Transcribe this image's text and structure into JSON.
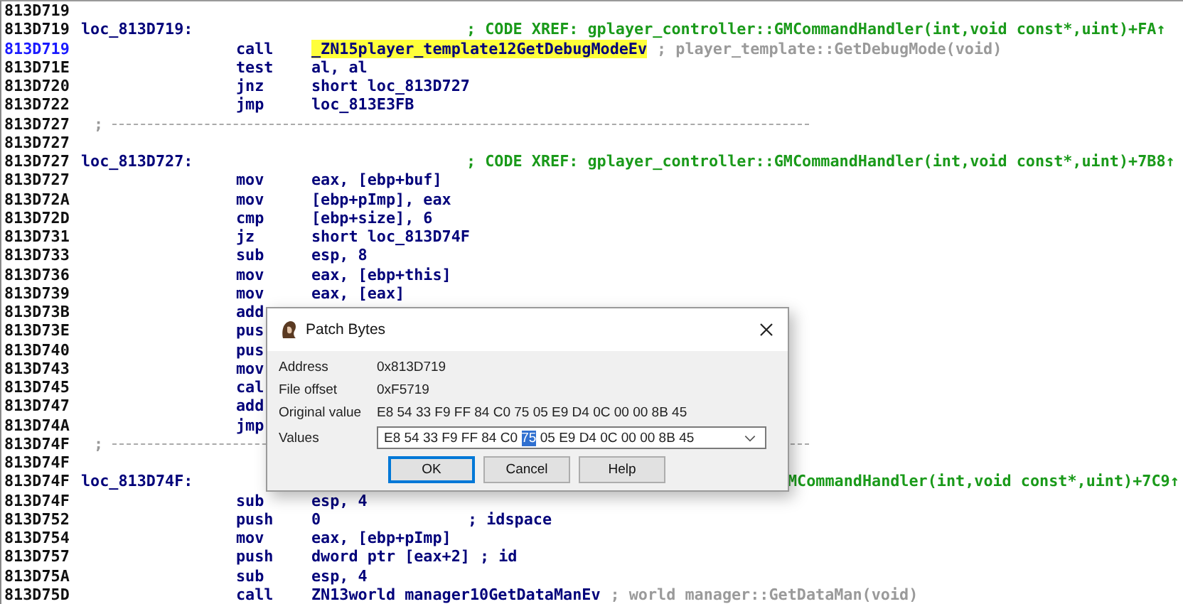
{
  "listing": {
    "rows": [
      {
        "kind": "blank",
        "address": "813D719",
        "current": false
      },
      {
        "kind": "label",
        "address": "813D719",
        "current": false,
        "label": "loc_813D719:",
        "comment": {
          "kind": "xref",
          "text": "; CODE XREF: gplayer_controller::GMCommandHandler(int,void const*,uint)+FA↑"
        }
      },
      {
        "kind": "code",
        "address": "813D719",
        "current": true,
        "mnemonic": "call",
        "operand": "_ZN15player_template12GetDebugModeEv",
        "highlighted": true,
        "comment": {
          "kind": "demangled",
          "text": "; player_template::GetDebugMode(void)"
        }
      },
      {
        "kind": "code",
        "address": "813D71E",
        "current": false,
        "mnemonic": "test",
        "operand": "al, al",
        "highlighted": false
      },
      {
        "kind": "code",
        "address": "813D720",
        "current": false,
        "mnemonic": "jnz",
        "operand": "short loc_813D727",
        "highlighted": false
      },
      {
        "kind": "code",
        "address": "813D722",
        "current": false,
        "mnemonic": "jmp",
        "operand": "loc_813E3FB",
        "highlighted": false
      },
      {
        "kind": "separator",
        "address": "813D727",
        "current": false,
        "text": ";"
      },
      {
        "kind": "blank",
        "address": "813D727",
        "current": false
      },
      {
        "kind": "label",
        "address": "813D727",
        "current": false,
        "label": "loc_813D727:",
        "comment": {
          "kind": "xref",
          "text": "; CODE XREF: gplayer_controller::GMCommandHandler(int,void const*,uint)+7B8↑"
        }
      },
      {
        "kind": "code",
        "address": "813D727",
        "current": false,
        "mnemonic": "mov",
        "operand": "eax, [ebp+buf]",
        "highlighted": false
      },
      {
        "kind": "code",
        "address": "813D72A",
        "current": false,
        "mnemonic": "mov",
        "operand": "[ebp+pImp], eax",
        "highlighted": false
      },
      {
        "kind": "code",
        "address": "813D72D",
        "current": false,
        "mnemonic": "cmp",
        "operand": "[ebp+size], 6",
        "highlighted": false
      },
      {
        "kind": "code",
        "address": "813D731",
        "current": false,
        "mnemonic": "jz",
        "operand": "short loc_813D74F",
        "highlighted": false
      },
      {
        "kind": "code",
        "address": "813D733",
        "current": false,
        "mnemonic": "sub",
        "operand": "esp, 8",
        "highlighted": false
      },
      {
        "kind": "code",
        "address": "813D736",
        "current": false,
        "mnemonic": "mov",
        "operand": "eax, [ebp+this]",
        "highlighted": false
      },
      {
        "kind": "code",
        "address": "813D739",
        "current": false,
        "mnemonic": "mov",
        "operand": "eax, [eax]",
        "highlighted": false
      },
      {
        "kind": "code",
        "address": "813D73B",
        "current": false,
        "mnemonic": "add"
      },
      {
        "kind": "code",
        "address": "813D73E",
        "current": false,
        "mnemonic": "pus"
      },
      {
        "kind": "code",
        "address": "813D740",
        "current": false,
        "mnemonic": "pus"
      },
      {
        "kind": "code",
        "address": "813D743",
        "current": false,
        "mnemonic": "mov"
      },
      {
        "kind": "code",
        "address": "813D745",
        "current": false,
        "mnemonic": "cal"
      },
      {
        "kind": "code",
        "address": "813D747",
        "current": false,
        "mnemonic": "add"
      },
      {
        "kind": "code",
        "address": "813D74A",
        "current": false,
        "mnemonic": "jmp"
      },
      {
        "kind": "separator",
        "address": "813D74F",
        "current": false,
        "text": ";"
      },
      {
        "kind": "blank",
        "address": "813D74F",
        "current": false
      },
      {
        "kind": "label",
        "address": "813D74F",
        "current": false,
        "label": "loc_813D74F:",
        "comment": {
          "kind": "xref_partial",
          "text": "MCommandHandler(int,void const*,uint)+7C9↑"
        }
      },
      {
        "kind": "code",
        "address": "813D74F",
        "current": false,
        "mnemonic": "sub",
        "operand": "esp, 4",
        "highlighted": false
      },
      {
        "kind": "code",
        "address": "813D752",
        "current": false,
        "mnemonic": "push",
        "operand": "0",
        "highlighted": false,
        "comment": {
          "kind": "note_column",
          "text": "; idspace"
        }
      },
      {
        "kind": "code",
        "address": "813D754",
        "current": false,
        "mnemonic": "mov",
        "operand": "eax, [ebp+pImp]",
        "highlighted": false
      },
      {
        "kind": "code",
        "address": "813D757",
        "current": false,
        "mnemonic": "push",
        "operand": "dword ptr [eax+2]",
        "highlighted": false,
        "comment": {
          "kind": "note",
          "text": "; id"
        }
      },
      {
        "kind": "code",
        "address": "813D75A",
        "current": false,
        "mnemonic": "sub",
        "operand": "esp, 4",
        "highlighted": false
      },
      {
        "kind": "code",
        "address": "813D75D",
        "current": false,
        "mnemonic": "call",
        "operand": "ZN13world manager10GetDataManEv",
        "highlighted": false,
        "comment": {
          "kind": "demangled",
          "text": "; world manager::GetDataMan(void)"
        }
      }
    ]
  },
  "dialog": {
    "title": "Patch Bytes",
    "fields": [
      {
        "label": "Address",
        "value": "0x813D719"
      },
      {
        "label": "File offset",
        "value": "0xF5719"
      },
      {
        "label": "Original value",
        "value": "E8 54 33 F9 FF 84 C0 75 05 E9 D4 0C 00 00 8B 45"
      }
    ],
    "values": {
      "label": "Values",
      "before": "E8 54 33 F9 FF 84 C0 ",
      "selection": "75",
      "after": " 05 E9 D4 0C 00 00 8B 45"
    },
    "buttons": [
      {
        "label": "OK",
        "focused": true
      },
      {
        "label": "Cancel",
        "focused": false
      },
      {
        "label": "Help",
        "focused": false
      }
    ]
  }
}
